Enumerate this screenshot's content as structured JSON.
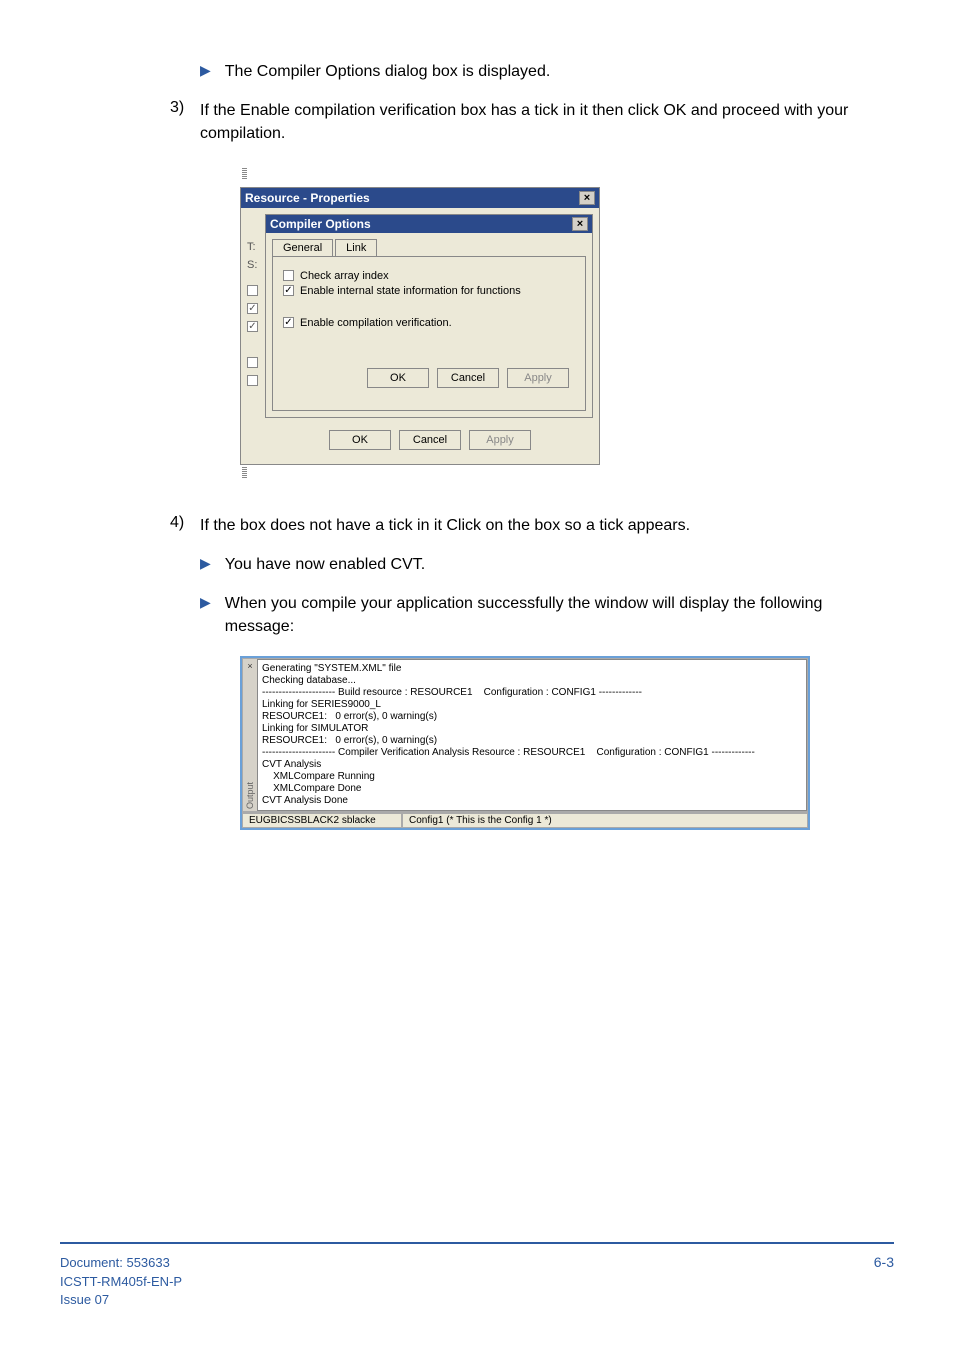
{
  "bullets": {
    "b1": "The Compiler Options dialog box is displayed.",
    "b2": "You have now enabled CVT.",
    "b3": "When you compile your application successfully the window will display the following message:"
  },
  "steps": {
    "s3_num": "3)",
    "s3_text": "If the Enable compilation verification box has a tick in it then click OK and proceed with your compilation.",
    "s4_num": "4)",
    "s4_text": "If the box does not have a tick in it Click on the box so a tick appears."
  },
  "dlg": {
    "outer_title": "Resource - Properties",
    "inner_title": "Compiler Options",
    "tab_general": "General",
    "tab_link": "Link",
    "cb_check_array": "Check array index",
    "cb_enable_internal": "Enable internal state information for functions",
    "cb_enable_compile": "Enable compilation verification.",
    "left1": "T:",
    "left2": "S:",
    "btn_ok": "OK",
    "btn_cancel": "Cancel",
    "btn_apply": "Apply"
  },
  "output": {
    "close_x": "×",
    "vtext": "Output",
    "body": "Generating \"SYSTEM.XML\" file\nChecking database...\n---------------------- Build resource : RESOURCE1    Configuration : CONFIG1 -------------\nLinking for SERIES9000_L\nRESOURCE1:   0 error(s), 0 warning(s)\nLinking for SIMULATOR\nRESOURCE1:   0 error(s), 0 warning(s)\n---------------------- Compiler Verification Analysis Resource : RESOURCE1    Configuration : CONFIG1 -------------\nCVT Analysis\n    XMLCompare Running\n    XMLCompare Done\nCVT Analysis Done",
    "status_left": "EUGBICSSBLACK2 sblacke",
    "status_right": "Config1 (* This is the Config 1 *)"
  },
  "footer": {
    "doc": "Document: 553633",
    "code": "ICSTT-RM405f-EN-P",
    "issue": "Issue 07",
    "page": "6-3"
  }
}
